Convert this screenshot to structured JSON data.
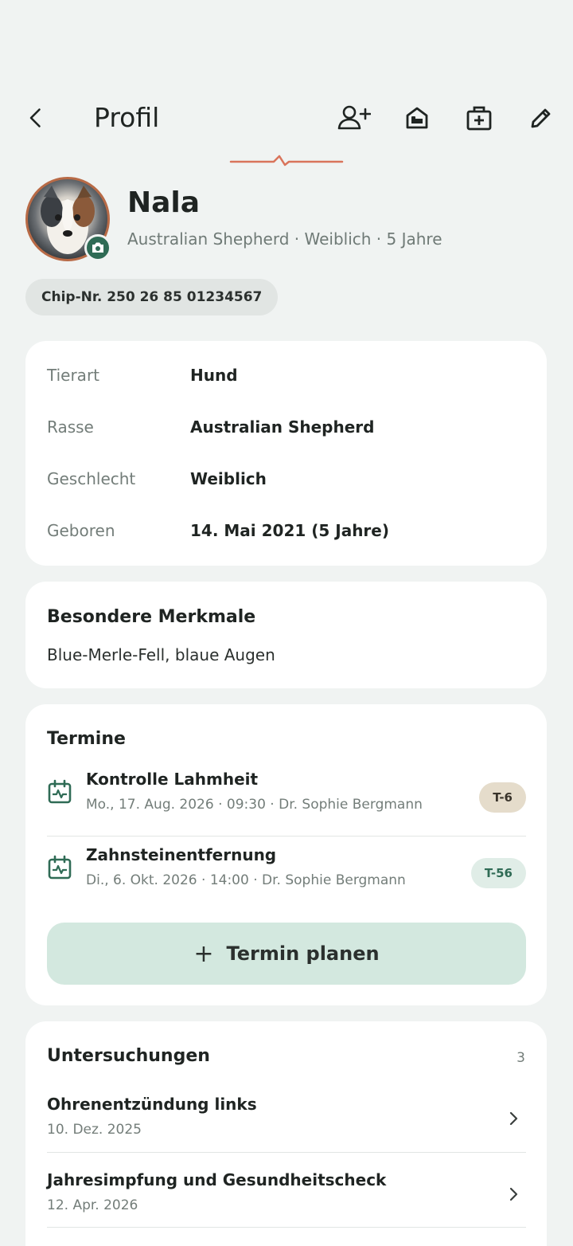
{
  "header": {
    "title": "Profil",
    "actions": [
      "add-owner-icon",
      "house-icon",
      "medical-kit-icon",
      "edit-icon"
    ]
  },
  "pet": {
    "name": "Nala",
    "subtitle": "Australian Shepherd · Weiblich · 5 Jahre",
    "chip": "Chip-Nr. 250 26 85 01234567"
  },
  "details": [
    {
      "label": "Tierart",
      "value": "Hund"
    },
    {
      "label": "Rasse",
      "value": "Australian Shepherd"
    },
    {
      "label": "Geschlecht",
      "value": "Weiblich"
    },
    {
      "label": "Geboren",
      "value": "14. Mai 2021 (5 Jahre)"
    }
  ],
  "merkmale": {
    "title": "Besondere Merkmale",
    "text": "Blue-Merle-Fell, blaue Augen"
  },
  "termine": {
    "title": "Termine",
    "items": [
      {
        "title": "Kontrolle Lahmheit",
        "meta": "Mo., 17. Aug. 2026 · 09:30 · Dr. Sophie Bergmann",
        "tag": "T-6"
      },
      {
        "title": "Zahnsteinentfernung",
        "meta": "Di., 6. Okt. 2026 · 14:00 · Dr. Sophie Bergmann",
        "tag": "T-56"
      }
    ],
    "plan_label": "Termin planen"
  },
  "untersuchungen": {
    "title": "Untersuchungen",
    "count": "3",
    "items": [
      {
        "title": "Ohrenentzündung links",
        "date": "10. Dez. 2025"
      },
      {
        "title": "Jahresimpfung und Gesundheitscheck",
        "date": "12. Apr. 2026"
      }
    ]
  },
  "colors": {
    "accent": "#2f6b55",
    "pulse": "#d9745b",
    "background": "#f0f3f2"
  }
}
